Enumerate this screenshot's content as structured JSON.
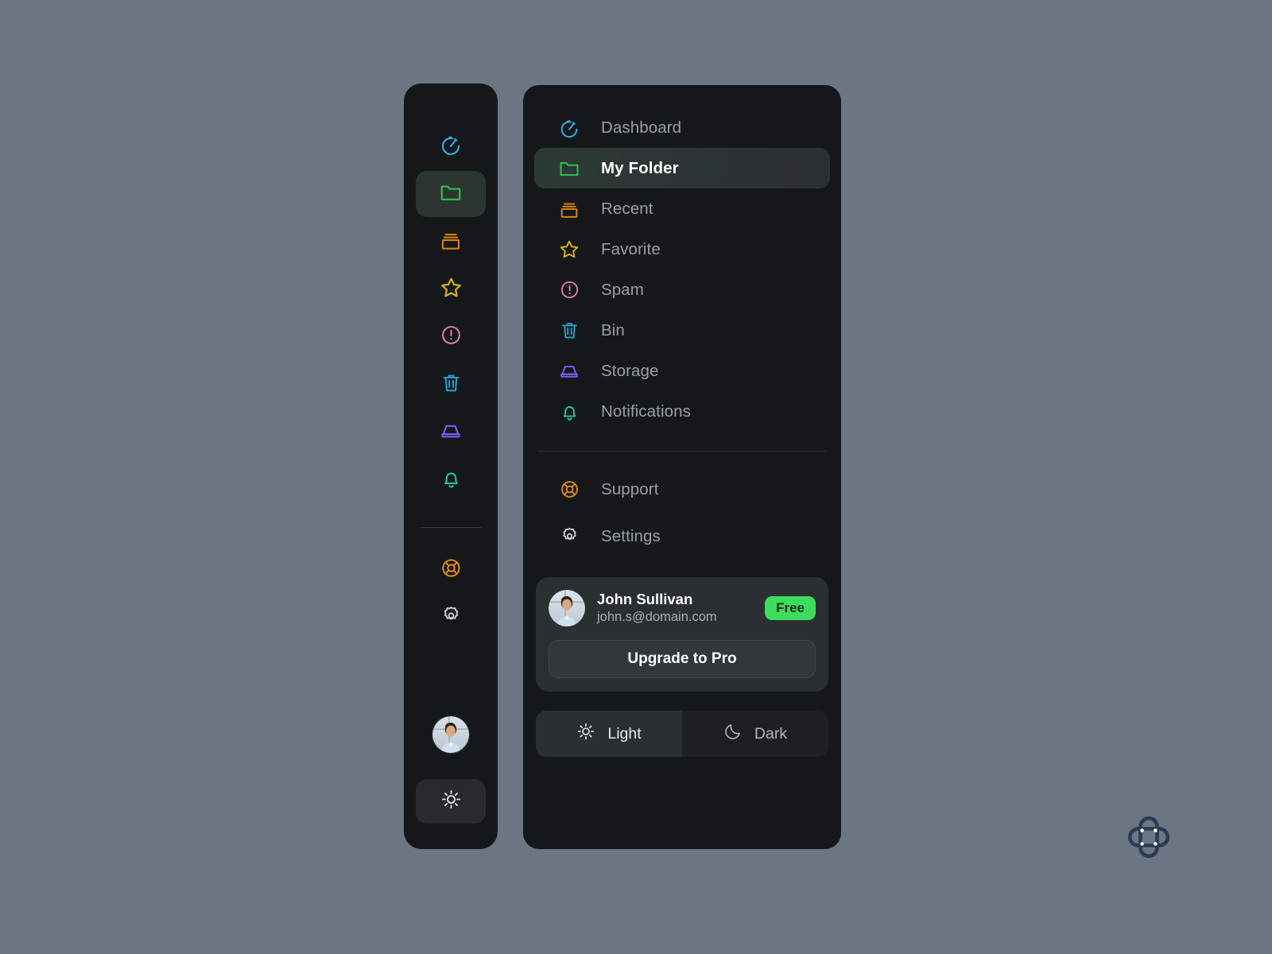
{
  "app": {
    "background_color": "#6b7682",
    "panel_color": "#151819",
    "accent_green": "#3ddc5f"
  },
  "nav": {
    "primary": [
      {
        "id": "dashboard",
        "label": "Dashboard",
        "icon": "stopwatch-icon",
        "color": "#3aa9e8",
        "active": false
      },
      {
        "id": "my-folder",
        "label": "My Folder",
        "icon": "folder-icon",
        "color": "#2ec14e",
        "active": true
      },
      {
        "id": "recent",
        "label": "Recent",
        "icon": "archive-icon",
        "color": "#d9820e",
        "active": false
      },
      {
        "id": "favorite",
        "label": "Favorite",
        "icon": "star-icon",
        "color": "#d7b012",
        "active": false
      },
      {
        "id": "spam",
        "label": "Spam",
        "icon": "alert-circle-icon",
        "color": "#e07ba8",
        "active": false
      },
      {
        "id": "bin",
        "label": "Bin",
        "icon": "trash-icon",
        "color": "#1f9fc4",
        "active": false
      },
      {
        "id": "storage",
        "label": "Storage",
        "icon": "hard-drive-icon",
        "color": "#7b5cf0",
        "active": false
      },
      {
        "id": "notifications",
        "label": "Notifications",
        "icon": "bell-icon",
        "color": "#21c99a",
        "active": false
      }
    ],
    "secondary": [
      {
        "id": "support",
        "label": "Support",
        "icon": "lifebuoy-icon",
        "color": "#e08a15",
        "active": false
      },
      {
        "id": "settings",
        "label": "Settings",
        "icon": "gear-icon",
        "color": "#c9ced1",
        "active": false
      }
    ]
  },
  "user_card": {
    "name": "John Sullivan",
    "email": "john.s@domain.com",
    "plan_badge": "Free",
    "upgrade_label": "Upgrade to Pro",
    "avatar_name": "user-avatar-photo"
  },
  "theme_switch": {
    "options": [
      {
        "id": "light",
        "label": "Light",
        "icon": "sun-icon",
        "selected": true
      },
      {
        "id": "dark",
        "label": "Dark",
        "icon": "moon-icon",
        "selected": false
      }
    ]
  },
  "rail": {
    "theme_button_icon": "sun-icon",
    "avatar_name": "rail-avatar-photo"
  },
  "brand": {
    "logo_name": "quatrefoil-logo",
    "logo_color": "#2a3a56"
  }
}
